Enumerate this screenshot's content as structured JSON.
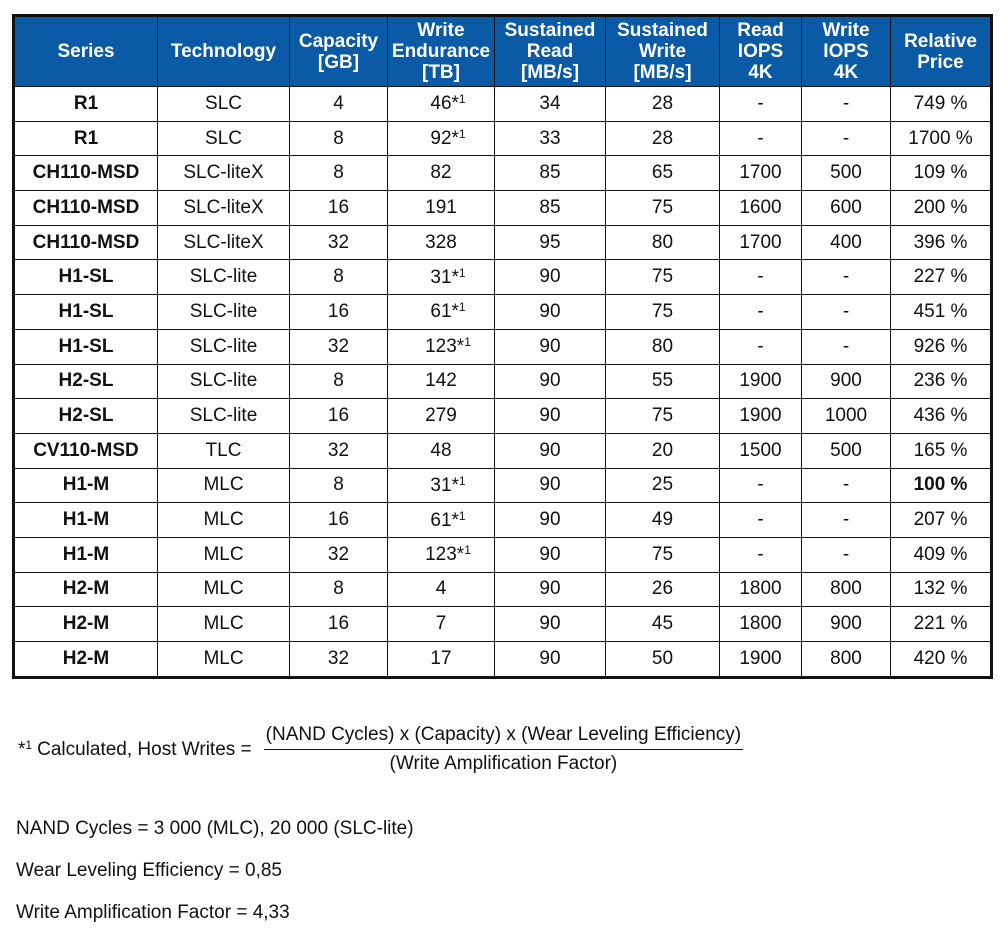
{
  "table": {
    "header_color": "#0b5aa5",
    "columns": [
      {
        "lines": [
          "Series"
        ]
      },
      {
        "lines": [
          "Technology"
        ]
      },
      {
        "lines": [
          "Capacity",
          "[GB]"
        ]
      },
      {
        "lines": [
          "Write",
          "Endurance",
          "[TB]"
        ]
      },
      {
        "lines": [
          "Sustained",
          "Read",
          "[MB/s]"
        ]
      },
      {
        "lines": [
          "Sustained",
          "Write",
          "[MB/s]"
        ]
      },
      {
        "lines": [
          "Read",
          "IOPS",
          "4K"
        ]
      },
      {
        "lines": [
          "Write",
          "IOPS",
          "4K"
        ]
      },
      {
        "lines": [
          "Relative",
          "Price"
        ]
      }
    ],
    "rows": [
      {
        "series": "R1",
        "technology": "SLC",
        "capacity": "4",
        "endurance": "46",
        "endurance_note": "*1",
        "read": "34",
        "write": "28",
        "read_iops": "-",
        "write_iops": "-",
        "price": "749 %",
        "price_bold": false
      },
      {
        "series": "R1",
        "technology": "SLC",
        "capacity": "8",
        "endurance": "92",
        "endurance_note": "*1",
        "read": "33",
        "write": "28",
        "read_iops": "-",
        "write_iops": "-",
        "price": "1700 %",
        "price_bold": false
      },
      {
        "series": "CH110-MSD",
        "technology": "SLC-liteX",
        "capacity": "8",
        "endurance": "82",
        "endurance_note": "",
        "read": "85",
        "write": "65",
        "read_iops": "1700",
        "write_iops": "500",
        "price": "109 %",
        "price_bold": false
      },
      {
        "series": "CH110-MSD",
        "technology": "SLC-liteX",
        "capacity": "16",
        "endurance": "191",
        "endurance_note": "",
        "read": "85",
        "write": "75",
        "read_iops": "1600",
        "write_iops": "600",
        "price": "200 %",
        "price_bold": false
      },
      {
        "series": "CH110-MSD",
        "technology": "SLC-liteX",
        "capacity": "32",
        "endurance": "328",
        "endurance_note": "",
        "read": "95",
        "write": "80",
        "read_iops": "1700",
        "write_iops": "400",
        "price": "396 %",
        "price_bold": false
      },
      {
        "series": "H1-SL",
        "technology": "SLC-lite",
        "capacity": "8",
        "endurance": "31",
        "endurance_note": "*1",
        "read": "90",
        "write": "75",
        "read_iops": "-",
        "write_iops": "-",
        "price": "227 %",
        "price_bold": false
      },
      {
        "series": "H1-SL",
        "technology": "SLC-lite",
        "capacity": "16",
        "endurance": "61",
        "endurance_note": "*1",
        "read": "90",
        "write": "75",
        "read_iops": "-",
        "write_iops": "-",
        "price": "451 %",
        "price_bold": false
      },
      {
        "series": "H1-SL",
        "technology": "SLC-lite",
        "capacity": "32",
        "endurance": "123",
        "endurance_note": "*1",
        "read": "90",
        "write": "80",
        "read_iops": "-",
        "write_iops": "-",
        "price": "926 %",
        "price_bold": false
      },
      {
        "series": "H2-SL",
        "technology": "SLC-lite",
        "capacity": "8",
        "endurance": "142",
        "endurance_note": "",
        "read": "90",
        "write": "55",
        "read_iops": "1900",
        "write_iops": "900",
        "price": "236 %",
        "price_bold": false
      },
      {
        "series": "H2-SL",
        "technology": "SLC-lite",
        "capacity": "16",
        "endurance": "279",
        "endurance_note": "",
        "read": "90",
        "write": "75",
        "read_iops": "1900",
        "write_iops": "1000",
        "price": "436 %",
        "price_bold": false
      },
      {
        "series": "CV110-MSD",
        "technology": "TLC",
        "capacity": "32",
        "endurance": "48",
        "endurance_note": "",
        "read": "90",
        "write": "20",
        "read_iops": "1500",
        "write_iops": "500",
        "price": "165 %",
        "price_bold": false
      },
      {
        "series": "H1-M",
        "technology": "MLC",
        "capacity": "8",
        "endurance": "31",
        "endurance_note": "*1",
        "read": "90",
        "write": "25",
        "read_iops": "-",
        "write_iops": "-",
        "price": "100 %",
        "price_bold": true
      },
      {
        "series": "H1-M",
        "technology": "MLC",
        "capacity": "16",
        "endurance": "61",
        "endurance_note": "*1",
        "read": "90",
        "write": "49",
        "read_iops": "-",
        "write_iops": "-",
        "price": "207 %",
        "price_bold": false
      },
      {
        "series": "H1-M",
        "technology": "MLC",
        "capacity": "32",
        "endurance": "123",
        "endurance_note": "*1",
        "read": "90",
        "write": "75",
        "read_iops": "-",
        "write_iops": "-",
        "price": "409 %",
        "price_bold": false
      },
      {
        "series": "H2-M",
        "technology": "MLC",
        "capacity": "8",
        "endurance": "4",
        "endurance_note": "",
        "read": "90",
        "write": "26",
        "read_iops": "1800",
        "write_iops": "800",
        "price": "132 %",
        "price_bold": false
      },
      {
        "series": "H2-M",
        "technology": "MLC",
        "capacity": "16",
        "endurance": "7",
        "endurance_note": "",
        "read": "90",
        "write": "45",
        "read_iops": "1800",
        "write_iops": "900",
        "price": "221 %",
        "price_bold": false
      },
      {
        "series": "H2-M",
        "technology": "MLC",
        "capacity": "32",
        "endurance": "17",
        "endurance_note": "",
        "read": "90",
        "write": "50",
        "read_iops": "1900",
        "write_iops": "800",
        "price": "420 %",
        "price_bold": false
      }
    ]
  },
  "footnote": {
    "marker": "*",
    "marker_sup": "1",
    "label": "Calculated, Host Writes =",
    "numerator": "(NAND Cycles) x (Capacity) x (Wear Leveling Efficiency)",
    "denominator": "(Write Amplification Factor)"
  },
  "notes": [
    "NAND Cycles = 3 000 (MLC), 20 000 (SLC-lite)",
    "Wear Leveling Efficiency = 0,85",
    "Write Amplification Factor = 4,33"
  ]
}
